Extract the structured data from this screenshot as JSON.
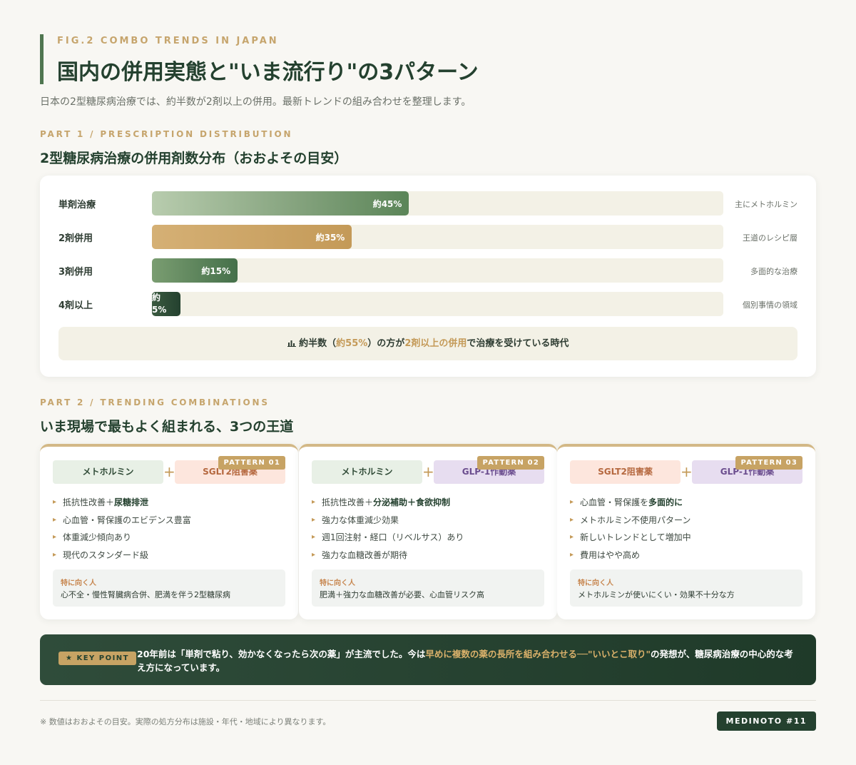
{
  "header": {
    "fig_label": "FIG.2 COMBO TRENDS IN JAPAN",
    "title": "国内の併用実態と\"いま流行り\"の3パターン",
    "subtitle": "日本の2型糖尿病治療では、約半数が2剤以上の併用。最新トレンドの組み合わせを整理します。"
  },
  "part1": {
    "label": "PART 1 / PRESCRIPTION DISTRIBUTION",
    "title": "2型糖尿病治療の併用剤数分布（おおよその目安）",
    "bars": [
      {
        "label": "単剤治療",
        "value_label": "約45%",
        "percent": 45,
        "note": "主にメトホルミン"
      },
      {
        "label": "2剤併用",
        "value_label": "約35%",
        "percent": 35,
        "note": "王道のレシピ層"
      },
      {
        "label": "3剤併用",
        "value_label": "約15%",
        "percent": 15,
        "note": "多面的な治療"
      },
      {
        "label": "4剤以上",
        "value_label": "約5%",
        "percent": 5,
        "note": "個別事情の領域"
      }
    ],
    "summary": {
      "icon": "bar-chart-icon",
      "prefix": "約半数（",
      "highlight1": "約55%",
      "middle": "）の方が",
      "highlight2": "2剤以上の併用",
      "suffix": "で治療を受けている時代"
    }
  },
  "part2": {
    "label": "PART 2 / TRENDING COMBINATIONS",
    "title": "いま現場で最もよく組まれる、3つの王道",
    "fit_label": "特に向く人",
    "patterns": [
      {
        "badge": "PATTERN 01",
        "drug_a": "メトホルミン",
        "drug_b": "SGLT2阻害薬",
        "features": [
          {
            "text": "抵抗性改善＋",
            "bold": "尿糖排泄"
          },
          {
            "text": "心血管・腎保護のエビデンス豊富",
            "bold": ""
          },
          {
            "text": "体重減少傾向あり",
            "bold": ""
          },
          {
            "text": "現代のスタンダード級",
            "bold": ""
          }
        ],
        "fit": "心不全・慢性腎臓病合併、肥満を伴う2型糖尿病"
      },
      {
        "badge": "PATTERN 02",
        "drug_a": "メトホルミン",
        "drug_b": "GLP-1作動薬",
        "features": [
          {
            "text": "抵抗性改善＋",
            "bold": "分泌補助＋食欲抑制"
          },
          {
            "text": "強力な体重減少効果",
            "bold": ""
          },
          {
            "text": "週1回注射・経口（リベルサス）あり",
            "bold": ""
          },
          {
            "text": "強力な血糖改善が期待",
            "bold": ""
          }
        ],
        "fit": "肥満＋強力な血糖改善が必要、心血管リスク高"
      },
      {
        "badge": "PATTERN 03",
        "drug_a": "SGLT2阻害薬",
        "drug_b": "GLP-1作動薬",
        "features": [
          {
            "text": "心血管・腎保護を",
            "bold": "多面的に"
          },
          {
            "text": "メトホルミン不使用パターン",
            "bold": ""
          },
          {
            "text": "新しいトレンドとして増加中",
            "bold": ""
          },
          {
            "text": "費用はやや高め",
            "bold": ""
          }
        ],
        "fit": "メトホルミンが使いにくい・効果不十分な方"
      }
    ]
  },
  "key_point": {
    "badge": "★ KEY POINT",
    "text_1": "20年前は「単剤で粘り、効かなくなったら次の薬」が主流でした。今は",
    "highlight": "早めに複数の薬の長所を組み合わせる──\"いいとこ取り\"",
    "text_2": "の発想が、糖尿病治療の中心的な考え方になっています。"
  },
  "footer": {
    "note": "※ 数値はおおよその目安。実際の処方分布は施設・年代・地域により異なります。",
    "brand": "MEDINOTO #11"
  }
}
